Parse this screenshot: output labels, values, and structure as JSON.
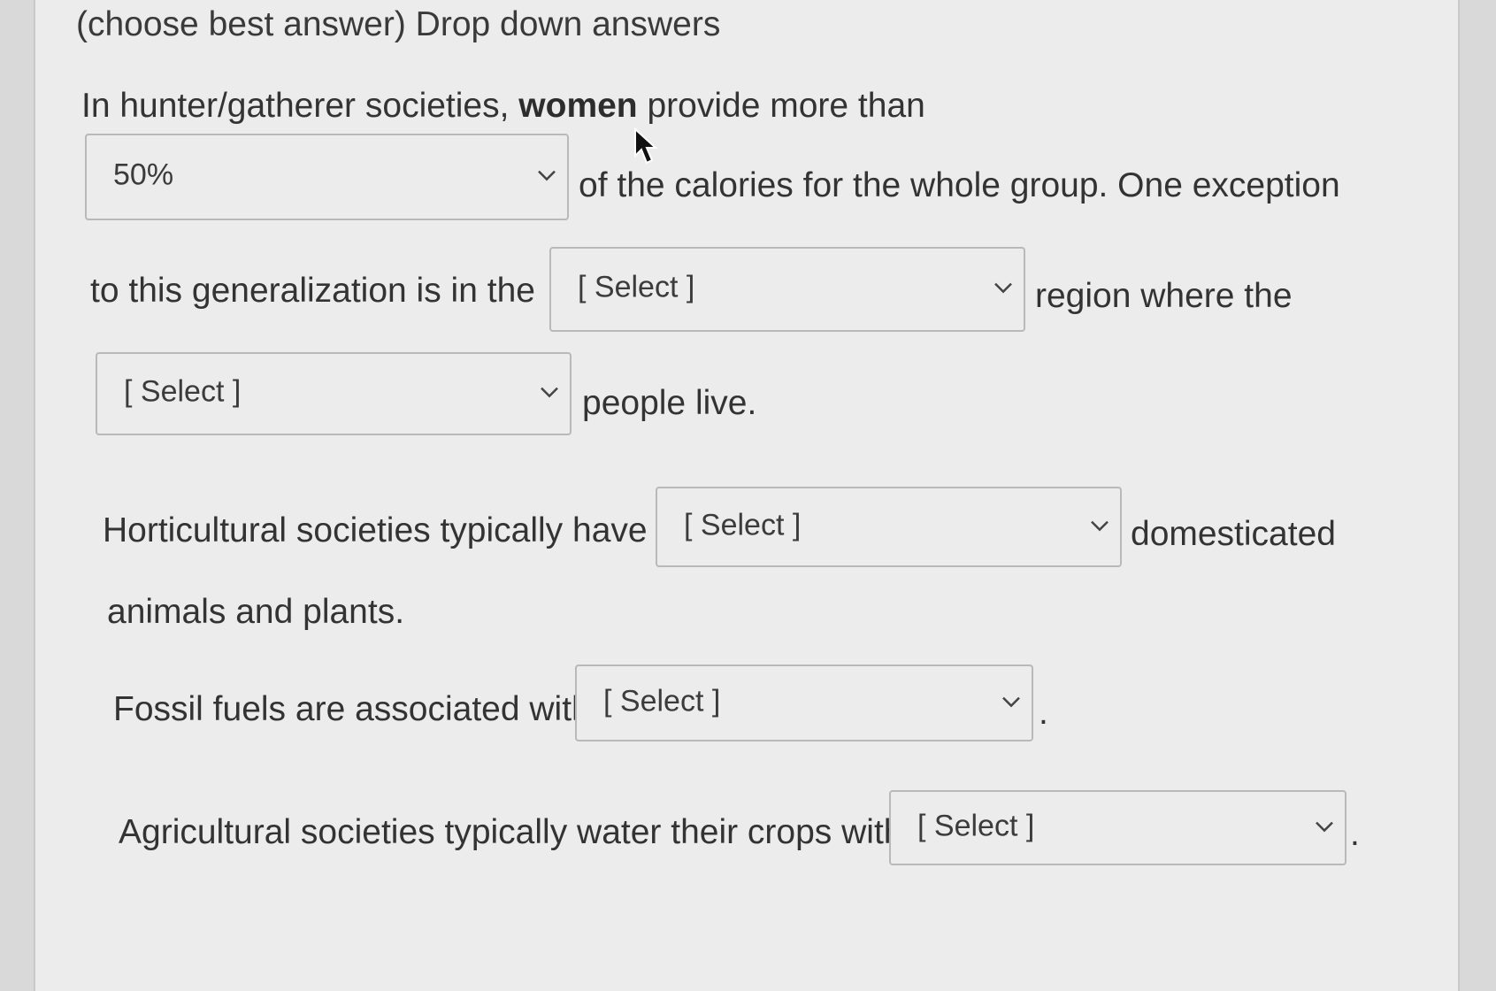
{
  "heading": "(choose best answer)  Drop down answers",
  "q1": {
    "text_a": "In hunter/gatherer societies, ",
    "text_bold": "women",
    "text_b": " provide more than",
    "select1_value": "50%",
    "text_c": "of the calories for the whole group.  One exception",
    "text_d": "to this generalization is in the",
    "select2_value": "[ Select ]",
    "text_e": "region where the",
    "select3_value": "[ Select ]",
    "text_f": "people live."
  },
  "q2": {
    "text_a": "Horticultural societies typically have",
    "select_value": "[ Select ]",
    "text_b": "domesticated",
    "text_c": "animals and plants."
  },
  "q3": {
    "text_a": "Fossil fuels are associated with",
    "select_value": "[ Select ]",
    "text_b": "."
  },
  "q4": {
    "text_a": "Agricultural societies typically water their crops with",
    "select_value": "[ Select ]",
    "text_b": "."
  },
  "icons": {
    "dropdown": "chevron-down-icon",
    "pointer": "mouse-cursor-icon"
  },
  "colors": {
    "background": "#ececec",
    "text": "#333333",
    "border": "#b9b9b9"
  }
}
